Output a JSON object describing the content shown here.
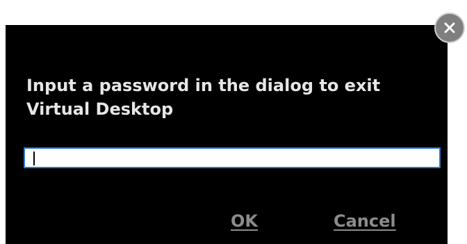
{
  "dialog": {
    "message": "Input a password in the dialog to exit Virtual Desktop",
    "password_value": "",
    "ok_label": "OK",
    "cancel_label": "Cancel",
    "close_icon": "close-icon"
  },
  "colors": {
    "dialog_background": "#000000",
    "message_text": "#e6e6e6",
    "button_text": "#8c8c8c",
    "input_border": "#2e78c8",
    "close_button": "#7f7f7f"
  }
}
